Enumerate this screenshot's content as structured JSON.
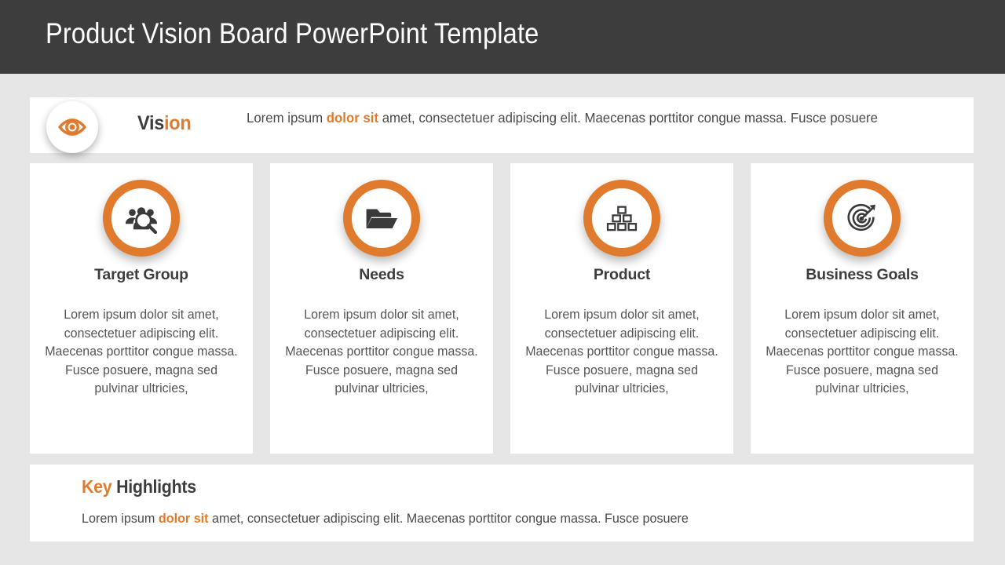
{
  "header": {
    "title": "Product Vision Board PowerPoint Template",
    "background_color": "#3d3d3d",
    "text_color": "#ffffff"
  },
  "theme": {
    "accent_color": "#e07b2e",
    "slide_background": "#e6e6e6",
    "panel_background": "#ffffff",
    "heading_color": "#3d3d3d",
    "body_color": "#555555"
  },
  "vision": {
    "icon": "eye-icon",
    "label_part1": "Vis",
    "label_part2": "ion",
    "body_pre": "Lorem ipsum ",
    "body_highlight": "dolor sit",
    "body_post": " amet, consectetuer adipiscing elit. Maecenas porttitor congue massa. Fusce posuere"
  },
  "cards": [
    {
      "icon": "target-group-icon",
      "title": "Target Group",
      "body": "Lorem ipsum dolor sit amet, consectetuer adipiscing elit. Maecenas porttitor congue massa. Fusce posuere, magna sed pulvinar ultricies,"
    },
    {
      "icon": "folder-icon",
      "title": "Needs",
      "body": "Lorem ipsum dolor sit amet, consectetuer adipiscing elit. Maecenas porttitor congue massa. Fusce posuere, magna sed pulvinar ultricies,"
    },
    {
      "icon": "blocks-pyramid-icon",
      "title": "Product",
      "body": "Lorem ipsum dolor sit amet, consectetuer adipiscing elit. Maecenas porttitor congue massa. Fusce posuere, magna sed pulvinar ultricies,"
    },
    {
      "icon": "target-arrow-icon",
      "title": "Business  Goals",
      "body": "Lorem ipsum dolor sit amet, consectetuer adipiscing elit. Maecenas porttitor congue massa. Fusce posuere, magna sed pulvinar ultricies,"
    }
  ],
  "highlights": {
    "title_part1": "Key",
    "title_part2": " Highlights",
    "body_pre": "Lorem ipsum ",
    "body_highlight": "dolor sit",
    "body_post": " amet, consectetuer adipiscing elit. Maecenas porttitor congue massa. Fusce posuere"
  }
}
